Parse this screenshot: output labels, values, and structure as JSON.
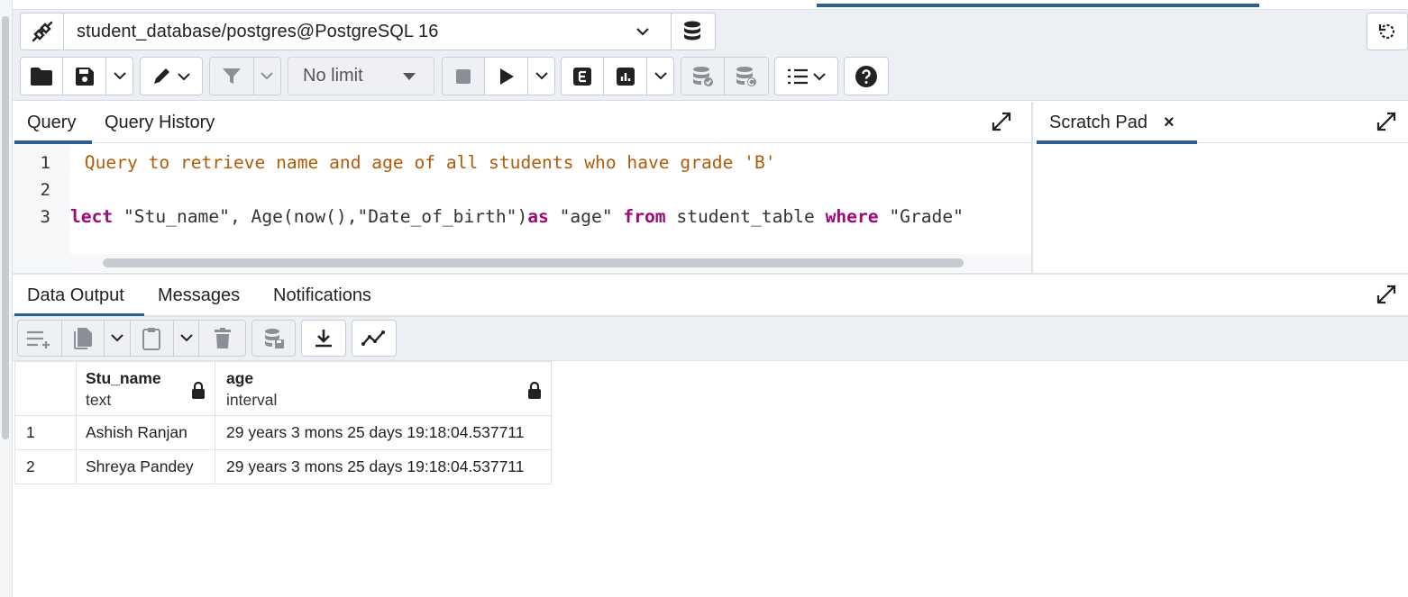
{
  "connection": {
    "label": "student_database/postgres@PostgreSQL 16"
  },
  "toolbar": {
    "limit_label": "No limit"
  },
  "query_tabs": [
    {
      "label": "Query"
    },
    {
      "label": "Query History"
    }
  ],
  "scratch": {
    "label": "Scratch Pad",
    "close": "×"
  },
  "editor": {
    "line_numbers": [
      "1",
      "2",
      "3"
    ],
    "line1": " Query to retrieve name and age of all students who have grade 'B'",
    "line3": {
      "kw1": "lect",
      "p1": " \"Stu_name\", Age(now(),\"Date_of_birth\")",
      "kw2": "as",
      "p2": " \"age\" ",
      "kw3": "from",
      "p3": " student_table ",
      "kw4": "where",
      "p4": " \"Grade\""
    }
  },
  "output_tabs": [
    {
      "label": "Data Output"
    },
    {
      "label": "Messages"
    },
    {
      "label": "Notifications"
    }
  ],
  "grid": {
    "columns": [
      {
        "name": "Stu_name",
        "type": "text"
      },
      {
        "name": "age",
        "type": "interval"
      }
    ],
    "rows": [
      {
        "num": "1",
        "stu_name": "Ashish Ranjan",
        "age": "29 years 3 mons 25 days 19:18:04.537711"
      },
      {
        "num": "2",
        "stu_name": "Shreya Pandey",
        "age": "29 years 3 mons 25 days 19:18:04.537711"
      }
    ]
  },
  "colors": {
    "accent": "#2d5f8e",
    "keyword": "#a10879",
    "comment": "#b15a08"
  }
}
